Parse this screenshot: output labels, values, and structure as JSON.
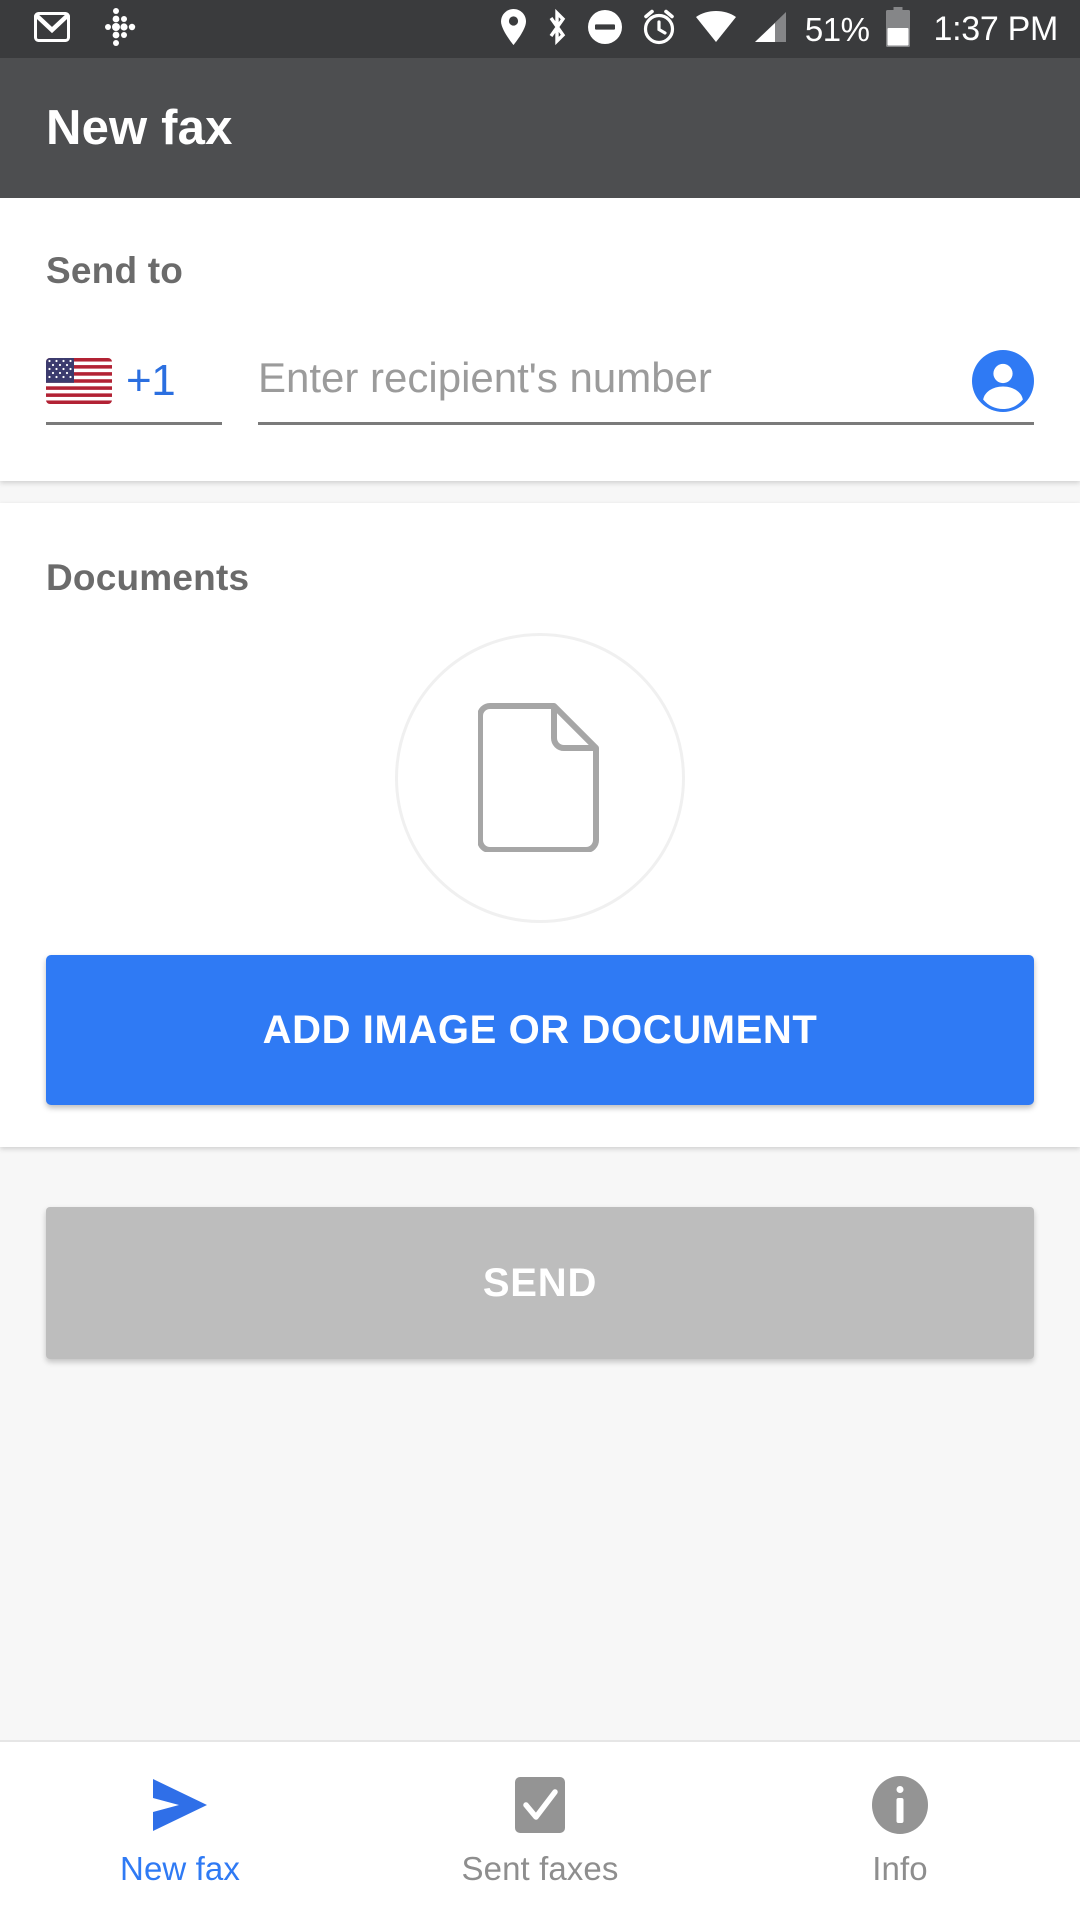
{
  "status_bar": {
    "left_icons": [
      "gmail-icon",
      "fitbit-dots-icon"
    ],
    "right_icons": [
      "location-pin-icon",
      "bluetooth-icon",
      "do-not-disturb-icon",
      "alarm-clock-icon",
      "wifi-icon",
      "cell-signal-icon"
    ],
    "battery_percent": "51%",
    "battery_level": 51,
    "time": "1:37 PM",
    "background_color": "#3a3b3d",
    "foreground_color": "#ffffff"
  },
  "app_bar": {
    "title": "New fax",
    "background_color": "#4d4e50"
  },
  "send_to": {
    "label": "Send to",
    "country_flag": "us-flag-icon",
    "country_code": "+1",
    "number_value": "",
    "number_placeholder": "Enter recipient's number",
    "contact_icon": "account-circle-icon",
    "accent_color": "#2b6fe0"
  },
  "documents": {
    "label": "Documents",
    "placeholder_icon": "document-page-icon",
    "add_button_label": "ADD IMAGE OR DOCUMENT",
    "add_button_color": "#2f7af4"
  },
  "send": {
    "button_label": "SEND",
    "button_color": "#bdbdbd",
    "enabled": false
  },
  "bottom_nav": {
    "items": [
      {
        "label": "New fax",
        "icon": "send-arrow-icon",
        "active": true
      },
      {
        "label": "Sent faxes",
        "icon": "checkbox-icon",
        "active": false
      },
      {
        "label": "Info",
        "icon": "info-circle-icon",
        "active": false
      }
    ],
    "active_color": "#2f7af4",
    "inactive_color": "#8e8e8e"
  }
}
